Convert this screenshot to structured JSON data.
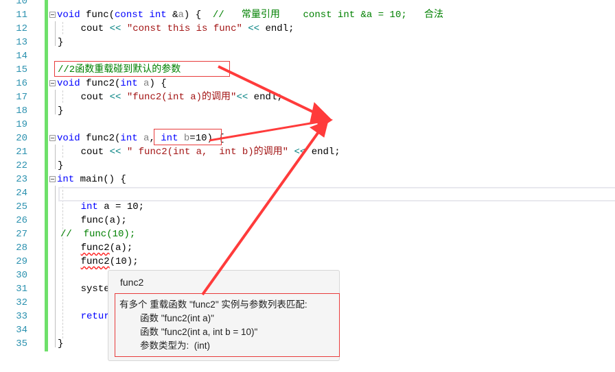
{
  "editor": {
    "line_numbers": [
      "10",
      "11",
      "12",
      "13",
      "14",
      "15",
      "16",
      "17",
      "18",
      "19",
      "20",
      "21",
      "22",
      "23",
      "24",
      "25",
      "26",
      "27",
      "28",
      "29",
      "30",
      "31",
      "32",
      "33",
      "34",
      "35"
    ],
    "lines": {
      "l11": {
        "kw1": "void",
        "t1": " func(",
        "kw2": "const",
        "sp": " ",
        "kw3": "int",
        "t2": " &",
        "p": "a",
        "t3": ") {  ",
        "cm": "//   常量引用    const int &a = 10;   合法"
      },
      "l12": {
        "t1": "    cout ",
        "op1": "<<",
        "sp": " ",
        "str": "\"const this is func\"",
        "sp2": " ",
        "op2": "<<",
        "t2": " endl;"
      },
      "l13": {
        "t1": "}"
      },
      "l15": {
        "cm": "//2函数重载碰到默认的参数"
      },
      "l16": {
        "kw1": "void",
        "t1": " func2(",
        "kw2": "int",
        "sp": " ",
        "p": "a",
        "t2": ") {"
      },
      "l17": {
        "t1": "    cout ",
        "op1": "<<",
        "sp": " ",
        "str": "\"func2(int a)的调用\"",
        "op2": "<<",
        "t2": " endl;"
      },
      "l18": {
        "t1": "}"
      },
      "l20": {
        "kw1": "void",
        "t1": " func2(",
        "kw2": "int",
        "sp": " ",
        "p1": "a",
        "t2": ", ",
        "kw3": "int",
        "sp2": " ",
        "p2": "b",
        "t3": "=10) {"
      },
      "l21": {
        "t1": "    cout ",
        "op1": "<<",
        "sp": " ",
        "str": "\" func2(int a,  int b)的调用\"",
        "sp2": " ",
        "op2": "<<",
        "t2": " endl;"
      },
      "l22": {
        "t1": "}"
      },
      "l23": {
        "kw1": "int",
        "t1": " main() {"
      },
      "l25": {
        "t0": "    ",
        "kw1": "int",
        "t1": " a = 10;"
      },
      "l26": {
        "t1": "    func(a);"
      },
      "l27": {
        "cm": "//  func(10);"
      },
      "l28": {
        "t0": "    ",
        "sq": "func2",
        "t1": "(a);"
      },
      "l29": {
        "t0": "    ",
        "sq": "func2",
        "t1": "(10);"
      },
      "l31": {
        "t1": "    syste"
      },
      "l33": {
        "t0": "    ",
        "kw1": "retur"
      },
      "l35": {
        "t1": "}"
      }
    }
  },
  "tooltip": {
    "title": "func2",
    "lines": [
      "有多个 重载函数 \"func2\" 实例与参数列表匹配:",
      "        函数 \"func2(int a)\"",
      "        函数 \"func2(int a, int b = 10)\"",
      "        参数类型为:  (int)"
    ]
  },
  "annotations": {
    "color": "#ff3b3b"
  }
}
